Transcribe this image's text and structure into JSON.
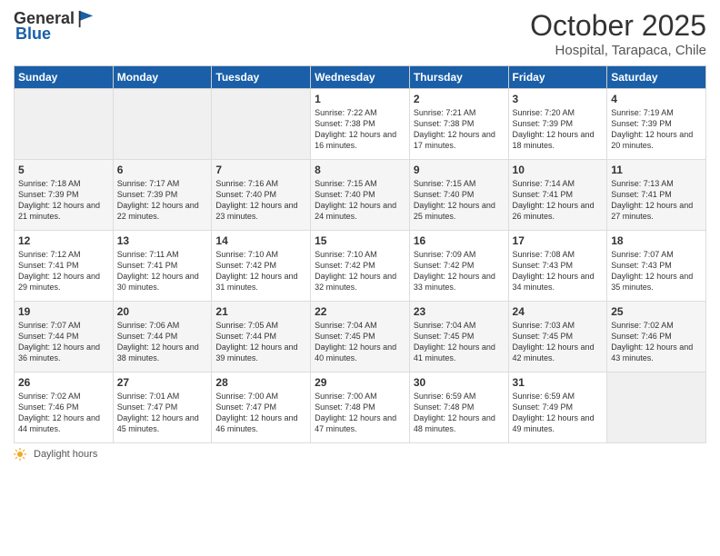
{
  "logo": {
    "general": "General",
    "blue": "Blue"
  },
  "header": {
    "title": "October 2025",
    "subtitle": "Hospital, Tarapaca, Chile"
  },
  "weekdays": [
    "Sunday",
    "Monday",
    "Tuesday",
    "Wednesday",
    "Thursday",
    "Friday",
    "Saturday"
  ],
  "weeks": [
    [
      {
        "day": "",
        "info": ""
      },
      {
        "day": "",
        "info": ""
      },
      {
        "day": "",
        "info": ""
      },
      {
        "day": "1",
        "info": "Sunrise: 7:22 AM\nSunset: 7:38 PM\nDaylight: 12 hours and 16 minutes."
      },
      {
        "day": "2",
        "info": "Sunrise: 7:21 AM\nSunset: 7:38 PM\nDaylight: 12 hours and 17 minutes."
      },
      {
        "day": "3",
        "info": "Sunrise: 7:20 AM\nSunset: 7:39 PM\nDaylight: 12 hours and 18 minutes."
      },
      {
        "day": "4",
        "info": "Sunrise: 7:19 AM\nSunset: 7:39 PM\nDaylight: 12 hours and 20 minutes."
      }
    ],
    [
      {
        "day": "5",
        "info": "Sunrise: 7:18 AM\nSunset: 7:39 PM\nDaylight: 12 hours and 21 minutes."
      },
      {
        "day": "6",
        "info": "Sunrise: 7:17 AM\nSunset: 7:39 PM\nDaylight: 12 hours and 22 minutes."
      },
      {
        "day": "7",
        "info": "Sunrise: 7:16 AM\nSunset: 7:40 PM\nDaylight: 12 hours and 23 minutes."
      },
      {
        "day": "8",
        "info": "Sunrise: 7:15 AM\nSunset: 7:40 PM\nDaylight: 12 hours and 24 minutes."
      },
      {
        "day": "9",
        "info": "Sunrise: 7:15 AM\nSunset: 7:40 PM\nDaylight: 12 hours and 25 minutes."
      },
      {
        "day": "10",
        "info": "Sunrise: 7:14 AM\nSunset: 7:41 PM\nDaylight: 12 hours and 26 minutes."
      },
      {
        "day": "11",
        "info": "Sunrise: 7:13 AM\nSunset: 7:41 PM\nDaylight: 12 hours and 27 minutes."
      }
    ],
    [
      {
        "day": "12",
        "info": "Sunrise: 7:12 AM\nSunset: 7:41 PM\nDaylight: 12 hours and 29 minutes."
      },
      {
        "day": "13",
        "info": "Sunrise: 7:11 AM\nSunset: 7:41 PM\nDaylight: 12 hours and 30 minutes."
      },
      {
        "day": "14",
        "info": "Sunrise: 7:10 AM\nSunset: 7:42 PM\nDaylight: 12 hours and 31 minutes."
      },
      {
        "day": "15",
        "info": "Sunrise: 7:10 AM\nSunset: 7:42 PM\nDaylight: 12 hours and 32 minutes."
      },
      {
        "day": "16",
        "info": "Sunrise: 7:09 AM\nSunset: 7:42 PM\nDaylight: 12 hours and 33 minutes."
      },
      {
        "day": "17",
        "info": "Sunrise: 7:08 AM\nSunset: 7:43 PM\nDaylight: 12 hours and 34 minutes."
      },
      {
        "day": "18",
        "info": "Sunrise: 7:07 AM\nSunset: 7:43 PM\nDaylight: 12 hours and 35 minutes."
      }
    ],
    [
      {
        "day": "19",
        "info": "Sunrise: 7:07 AM\nSunset: 7:44 PM\nDaylight: 12 hours and 36 minutes."
      },
      {
        "day": "20",
        "info": "Sunrise: 7:06 AM\nSunset: 7:44 PM\nDaylight: 12 hours and 38 minutes."
      },
      {
        "day": "21",
        "info": "Sunrise: 7:05 AM\nSunset: 7:44 PM\nDaylight: 12 hours and 39 minutes."
      },
      {
        "day": "22",
        "info": "Sunrise: 7:04 AM\nSunset: 7:45 PM\nDaylight: 12 hours and 40 minutes."
      },
      {
        "day": "23",
        "info": "Sunrise: 7:04 AM\nSunset: 7:45 PM\nDaylight: 12 hours and 41 minutes."
      },
      {
        "day": "24",
        "info": "Sunrise: 7:03 AM\nSunset: 7:45 PM\nDaylight: 12 hours and 42 minutes."
      },
      {
        "day": "25",
        "info": "Sunrise: 7:02 AM\nSunset: 7:46 PM\nDaylight: 12 hours and 43 minutes."
      }
    ],
    [
      {
        "day": "26",
        "info": "Sunrise: 7:02 AM\nSunset: 7:46 PM\nDaylight: 12 hours and 44 minutes."
      },
      {
        "day": "27",
        "info": "Sunrise: 7:01 AM\nSunset: 7:47 PM\nDaylight: 12 hours and 45 minutes."
      },
      {
        "day": "28",
        "info": "Sunrise: 7:00 AM\nSunset: 7:47 PM\nDaylight: 12 hours and 46 minutes."
      },
      {
        "day": "29",
        "info": "Sunrise: 7:00 AM\nSunset: 7:48 PM\nDaylight: 12 hours and 47 minutes."
      },
      {
        "day": "30",
        "info": "Sunrise: 6:59 AM\nSunset: 7:48 PM\nDaylight: 12 hours and 48 minutes."
      },
      {
        "day": "31",
        "info": "Sunrise: 6:59 AM\nSunset: 7:49 PM\nDaylight: 12 hours and 49 minutes."
      },
      {
        "day": "",
        "info": ""
      }
    ]
  ],
  "footer": {
    "note": "Daylight hours"
  }
}
